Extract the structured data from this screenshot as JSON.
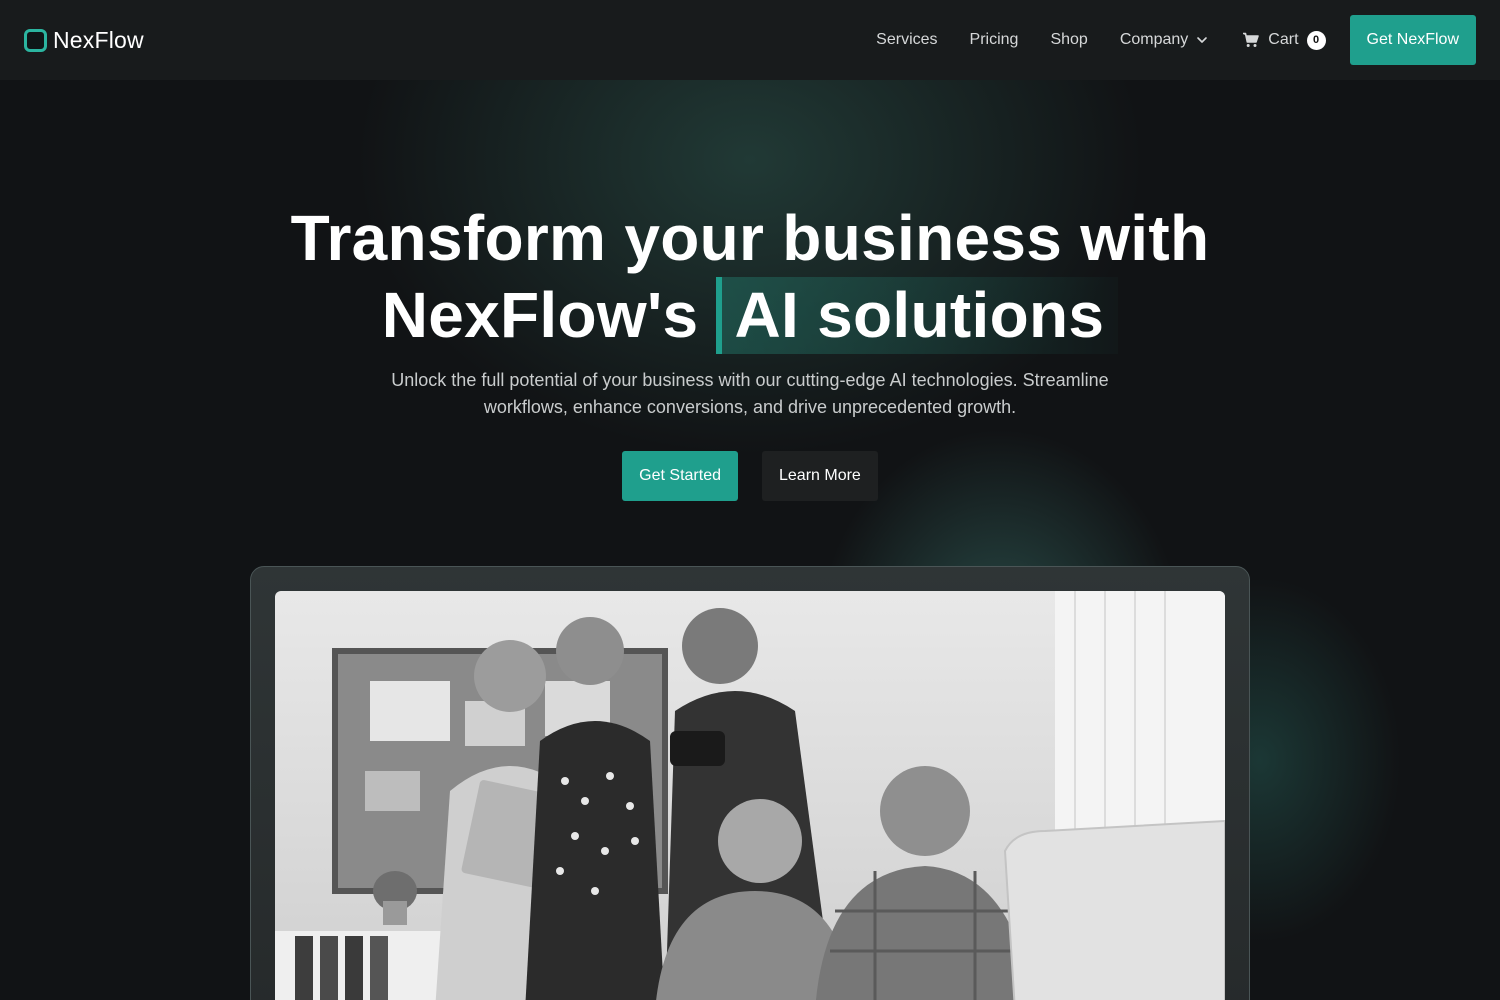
{
  "brand": {
    "name": "NexFlow"
  },
  "nav": {
    "links": [
      "Services",
      "Pricing",
      "Shop",
      "Company"
    ],
    "cart_label": "Cart",
    "cart_count": "0",
    "cta_label": "Get NexFlow"
  },
  "hero": {
    "title_line1": "Transform your business with",
    "title_line2_prefix": "NexFlow's",
    "title_highlight": "AI solutions",
    "subtitle": "Unlock the full potential of your business with our cutting-edge AI technologies. Streamline workflows, enhance conversions, and drive unprecedented growth.",
    "primary_button": "Get Started",
    "secondary_button": "Learn More"
  },
  "colors": {
    "accent": "#1f9f8d",
    "background": "#111315",
    "nav_background": "#181b1c"
  },
  "icons": [
    "logo-icon",
    "chevron-down-icon",
    "cart-icon"
  ]
}
